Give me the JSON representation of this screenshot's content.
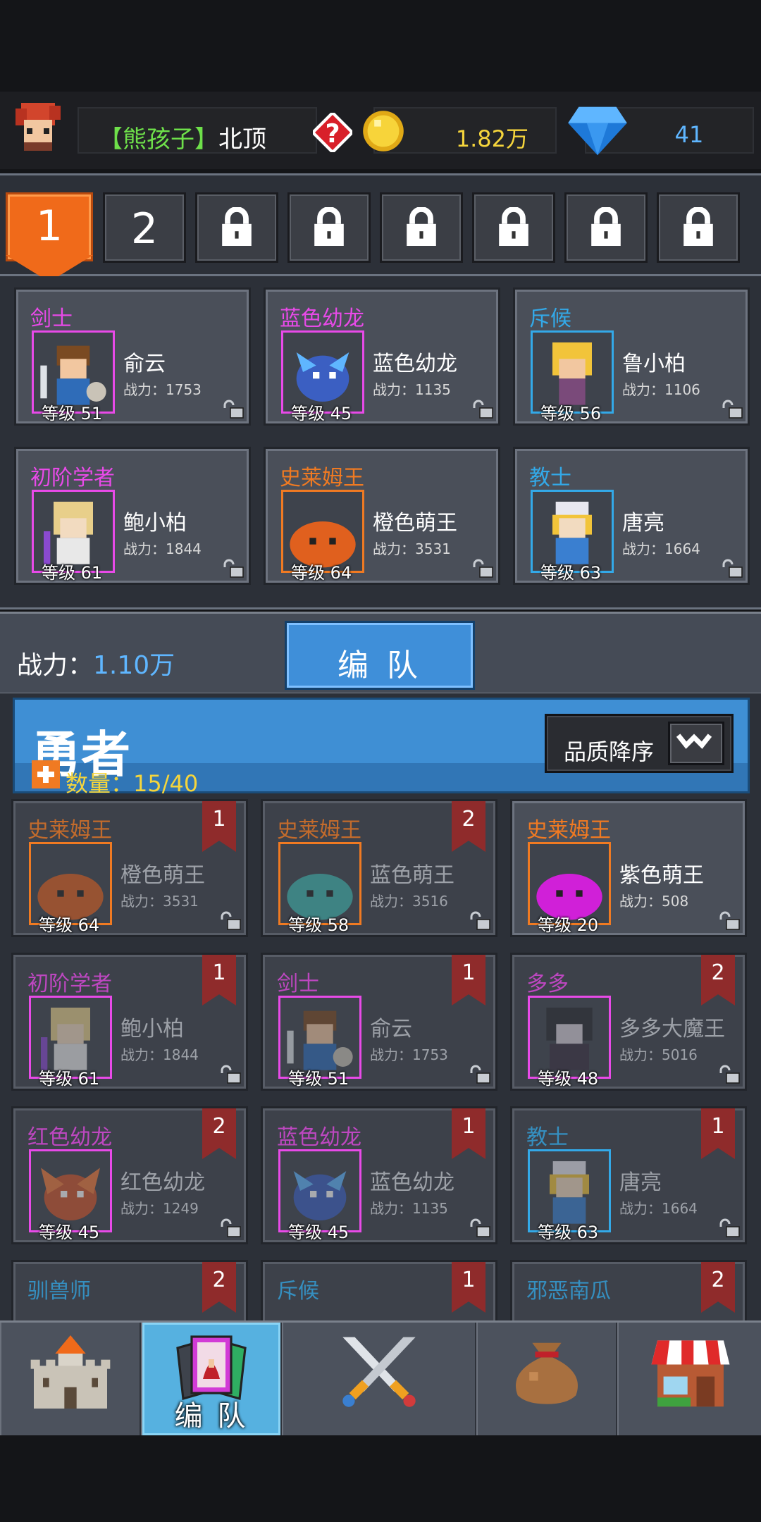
{
  "player": {
    "name_prefix": "【熊孩子】",
    "name_suffix": "北顶",
    "gold": "1.82万",
    "gems": "41"
  },
  "team_tabs": [
    {
      "label": "1",
      "state": "active"
    },
    {
      "label": "2",
      "state": "unlocked"
    },
    {
      "label": "",
      "state": "locked"
    },
    {
      "label": "",
      "state": "locked"
    },
    {
      "label": "",
      "state": "locked"
    },
    {
      "label": "",
      "state": "locked"
    },
    {
      "label": "",
      "state": "locked"
    },
    {
      "label": "",
      "state": "locked"
    }
  ],
  "team": [
    {
      "cls": "剑士",
      "cls_color": "#e84ae8",
      "name": "俞云",
      "power": "战力：1753",
      "level": "等级 51"
    },
    {
      "cls": "蓝色幼龙",
      "cls_color": "#e84ae8",
      "name": "蓝色幼龙",
      "power": "战力：1135",
      "level": "等级 45"
    },
    {
      "cls": "斥候",
      "cls_color": "#33a9e8",
      "name": "鲁小柏",
      "power": "战力：1106",
      "level": "等级 56"
    },
    {
      "cls": "初阶学者",
      "cls_color": "#e84ae8",
      "name": "鲍小柏",
      "power": "战力：1844",
      "level": "等级 61"
    },
    {
      "cls": "史莱姆王",
      "cls_color": "#f07a22",
      "name": "橙色萌王",
      "power": "战力：3531",
      "level": "等级 64"
    },
    {
      "cls": "教士",
      "cls_color": "#33a9e8",
      "name": "唐亮",
      "power": "战力：1664",
      "level": "等级 63"
    }
  ],
  "total_power_label": "战力：",
  "total_power_value": "1.10万",
  "formation_button": "编 队",
  "hero_section": {
    "title": "勇者",
    "count": "数量：15/40",
    "sort_label": "品质降序"
  },
  "heroes": [
    {
      "cls": "史莱姆王",
      "cls_color": "#f07a22",
      "name": "橙色萌王",
      "power": "战力：3531",
      "level": "等级 64",
      "ribbon": "1",
      "dim": true
    },
    {
      "cls": "史莱姆王",
      "cls_color": "#f07a22",
      "name": "蓝色萌王",
      "power": "战力：3516",
      "level": "等级 58",
      "ribbon": "2",
      "dim": true
    },
    {
      "cls": "史莱姆王",
      "cls_color": "#f07a22",
      "name": "紫色萌王",
      "power": "战力：508",
      "level": "等级 20",
      "ribbon": "",
      "dim": false
    },
    {
      "cls": "初阶学者",
      "cls_color": "#e84ae8",
      "name": "鲍小柏",
      "power": "战力：1844",
      "level": "等级 61",
      "ribbon": "1",
      "dim": true
    },
    {
      "cls": "剑士",
      "cls_color": "#e84ae8",
      "name": "俞云",
      "power": "战力：1753",
      "level": "等级 51",
      "ribbon": "1",
      "dim": true
    },
    {
      "cls": "多多",
      "cls_color": "#e84ae8",
      "name": "多多大魔王",
      "power": "战力：5016",
      "level": "等级 48",
      "ribbon": "2",
      "dim": true
    },
    {
      "cls": "红色幼龙",
      "cls_color": "#e84ae8",
      "name": "红色幼龙",
      "power": "战力：1249",
      "level": "等级 45",
      "ribbon": "2",
      "dim": true
    },
    {
      "cls": "蓝色幼龙",
      "cls_color": "#e84ae8",
      "name": "蓝色幼龙",
      "power": "战力：1135",
      "level": "等级 45",
      "ribbon": "1",
      "dim": true
    },
    {
      "cls": "教士",
      "cls_color": "#33a9e8",
      "name": "唐亮",
      "power": "战力：1664",
      "level": "等级 63",
      "ribbon": "1",
      "dim": true
    },
    {
      "cls": "驯兽师",
      "cls_color": "#33a9e8",
      "name": "",
      "power": "",
      "level": "",
      "ribbon": "2",
      "dim": true
    },
    {
      "cls": "斥候",
      "cls_color": "#33a9e8",
      "name": "",
      "power": "",
      "level": "",
      "ribbon": "1",
      "dim": true
    },
    {
      "cls": "邪恶南瓜",
      "cls_color": "#33a9e8",
      "name": "",
      "power": "",
      "level": "",
      "ribbon": "2",
      "dim": true
    }
  ],
  "nav": [
    {
      "icon": "castle-icon",
      "label": ""
    },
    {
      "icon": "formation-card-icon",
      "label": "编 队"
    },
    {
      "icon": "crossed-swords-icon",
      "label": ""
    },
    {
      "icon": "loot-bag-icon",
      "label": ""
    },
    {
      "icon": "shop-icon",
      "label": ""
    }
  ]
}
